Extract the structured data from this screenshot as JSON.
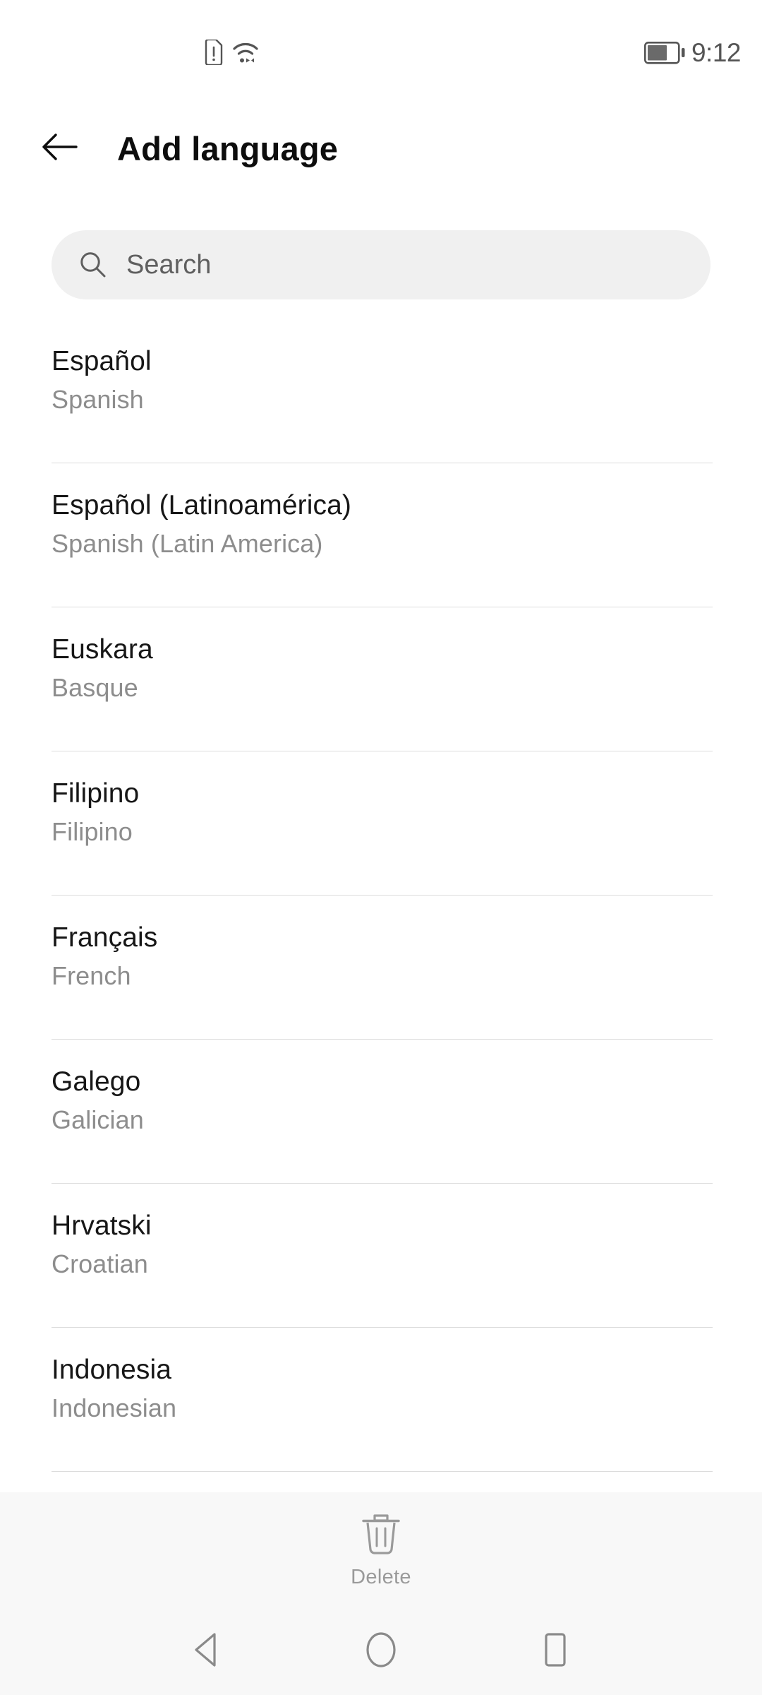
{
  "status_bar": {
    "icons": [
      "sim-alert-icon",
      "wifi-icon",
      "battery-icon"
    ],
    "battery_level_pct": 62,
    "time": "9:12"
  },
  "header": {
    "back_label": "back-arrow",
    "title": "Add language"
  },
  "search": {
    "placeholder": "Search",
    "value": "",
    "icon": "search-icon"
  },
  "languages": [
    {
      "native": "Español",
      "english": "Spanish"
    },
    {
      "native": "Español (Latinoamérica)",
      "english": "Spanish (Latin America)"
    },
    {
      "native": "Euskara",
      "english": "Basque"
    },
    {
      "native": "Filipino",
      "english": "Filipino"
    },
    {
      "native": "Français",
      "english": "French"
    },
    {
      "native": "Galego",
      "english": "Galician"
    },
    {
      "native": "Hrvatski",
      "english": "Croatian"
    },
    {
      "native": "Indonesia",
      "english": "Indonesian"
    }
  ],
  "action_bar": {
    "delete_label": "Delete",
    "delete_icon": "trash-icon"
  },
  "nav_bar": {
    "back": "back-triangle-icon",
    "home": "home-circle-icon",
    "recents": "recents-square-icon"
  },
  "colors": {
    "background": "#ffffff",
    "primary_text": "#161616",
    "secondary_text": "#8d8d8d",
    "divider": "#dcdcdc",
    "search_field": "#f0f0f0",
    "bottom_bar": "#f8f8f8",
    "icon_gray": "#9a9a9a",
    "status_icon": "#555555"
  }
}
